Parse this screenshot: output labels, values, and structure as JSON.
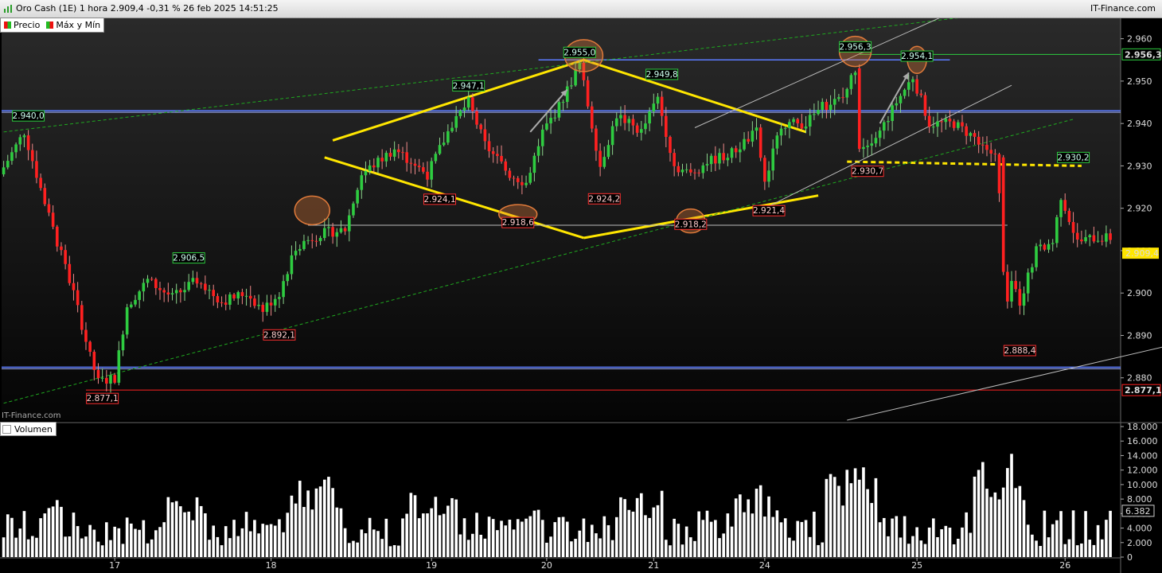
{
  "header": {
    "title": "Oro Cash (1E) 1 hora 2.909,4 -0,31 % 26 feb 2025 14:51:25",
    "brand": "IT-Finance.com"
  },
  "legend": {
    "price": "Precio",
    "maxmin": "Máx y Mín",
    "volume": "Volumen"
  },
  "watermark": "IT-Finance.com",
  "colors": {
    "up": "#2ecc40",
    "down": "#ff2020",
    "background": "#000000",
    "yellow": "#ffe600",
    "blue_line": "#5b7bff",
    "orange_circle": "#e07a3a"
  },
  "chart_data": {
    "type": "candlestick",
    "price_axis": {
      "range": [
        2870,
        2965
      ],
      "ticks": [
        "2.960",
        "2.950",
        "2.940",
        "2.930",
        "2.920",
        "2.910",
        "2.900",
        "2.890",
        "2.880"
      ],
      "tick_values": [
        2960,
        2950,
        2940,
        2930,
        2920,
        2910,
        2900,
        2890,
        2880
      ]
    },
    "volume_axis": {
      "range": [
        0,
        18000
      ],
      "ticks": [
        "18.000",
        "16.000",
        "14.000",
        "12.000",
        "10.000",
        "8.000",
        "6.000",
        "4.000",
        "2.000",
        "0"
      ],
      "tick_values": [
        18000,
        16000,
        14000,
        12000,
        10000,
        8000,
        6000,
        4000,
        2000,
        0
      ]
    },
    "x_labels": [
      "17",
      "18",
      "19",
      "20",
      "21",
      "24",
      "25",
      "26"
    ],
    "x_label_bar_index": [
      27,
      65,
      104,
      132,
      158,
      185,
      222,
      258
    ],
    "last_price": "2.909,4",
    "last_price_value": 2909.4,
    "last_volume": "6.382",
    "last_volume_value": 6382,
    "levels": [
      {
        "label": "2.956,3",
        "value": 2956.3,
        "color": "#2ecc40"
      },
      {
        "label": "2.877,1",
        "value": 2877.1,
        "color": "#ff2020"
      }
    ],
    "blue_levels": [
      2955,
      2943,
      2882.5
    ],
    "annotations": [
      {
        "text": "2.940,0",
        "bar": 6,
        "value": 2940.0,
        "kind": "high"
      },
      {
        "text": "2.906,5",
        "bar": 45,
        "value": 2906.5,
        "kind": "high"
      },
      {
        "text": "2.947,1",
        "bar": 113,
        "value": 2947.1,
        "kind": "high"
      },
      {
        "text": "2.955,0",
        "bar": 140,
        "value": 2955.0,
        "kind": "high"
      },
      {
        "text": "2.949,8",
        "bar": 160,
        "value": 2949.8,
        "kind": "high"
      },
      {
        "text": "2.956,3",
        "bar": 207,
        "value": 2956.3,
        "kind": "high"
      },
      {
        "text": "2.954,1",
        "bar": 222,
        "value": 2954.1,
        "kind": "high"
      },
      {
        "text": "2.930,2",
        "bar": 260,
        "value": 2930.2,
        "kind": "high"
      },
      {
        "text": "2.877,1",
        "bar": 24,
        "value": 2877.1,
        "kind": "low"
      },
      {
        "text": "2.892,1",
        "bar": 67,
        "value": 2892.1,
        "kind": "low"
      },
      {
        "text": "2.924,1",
        "bar": 106,
        "value": 2924.1,
        "kind": "low"
      },
      {
        "text": "2.918,6",
        "bar": 125,
        "value": 2918.6,
        "kind": "low"
      },
      {
        "text": "2.924,2",
        "bar": 146,
        "value": 2924.2,
        "kind": "low"
      },
      {
        "text": "2.918,2",
        "bar": 167,
        "value": 2918.2,
        "kind": "low"
      },
      {
        "text": "2.921,4",
        "bar": 186,
        "value": 2921.4,
        "kind": "low"
      },
      {
        "text": "2.930,7",
        "bar": 210,
        "value": 2930.7,
        "kind": "low"
      },
      {
        "text": "2.888,4",
        "bar": 247,
        "value": 2888.4,
        "kind": "low"
      }
    ],
    "trendlines": [
      {
        "color": "#ffe600",
        "width": 3,
        "dash": "",
        "p1": [
          80,
          2936
        ],
        "p2": [
          141,
          2955
        ]
      },
      {
        "color": "#ffe600",
        "width": 3,
        "dash": "",
        "p1": [
          78,
          2932
        ],
        "p2": [
          141,
          2913
        ]
      },
      {
        "color": "#ffe600",
        "width": 3,
        "dash": "",
        "p1": [
          141,
          2955
        ],
        "p2": [
          195,
          2938
        ]
      },
      {
        "color": "#ffe600",
        "width": 3,
        "dash": "",
        "p1": [
          141,
          2913
        ],
        "p2": [
          198,
          2923
        ]
      },
      {
        "color": "#ffe600",
        "width": 3,
        "dash": "6,4",
        "p1": [
          205,
          2931
        ],
        "p2": [
          262,
          2930
        ]
      },
      {
        "color": "#1fa81f",
        "width": 1,
        "dash": "4,3",
        "p1": [
          0,
          2874
        ],
        "p2": [
          260,
          2941
        ]
      },
      {
        "color": "#1fa81f",
        "width": 1,
        "dash": "4,3",
        "p1": [
          0,
          2938
        ],
        "p2": [
          250,
          2967
        ]
      },
      {
        "color": "#bbbbbb",
        "width": 1,
        "dash": "",
        "p1": [
          74,
          2916
        ],
        "p2": [
          244,
          2916
        ]
      },
      {
        "color": "#bbbbbb",
        "width": 1,
        "dash": "",
        "p1": [
          168,
          2939
        ],
        "p2": [
          230,
          2966
        ]
      },
      {
        "color": "#bbbbbb",
        "width": 1,
        "dash": "",
        "p1": [
          185,
          2920
        ],
        "p2": [
          245,
          2949
        ]
      },
      {
        "color": "#bbbbbb",
        "width": 1,
        "dash": "",
        "p1": [
          205,
          2870
        ],
        "p2": [
          285,
          2888
        ]
      }
    ],
    "circles": [
      {
        "bar": 75,
        "value": 2919.5,
        "rx": 22,
        "ry": 18
      },
      {
        "bar": 125,
        "value": 2918.6,
        "rx": 24,
        "ry": 12
      },
      {
        "bar": 141,
        "value": 2956,
        "rx": 24,
        "ry": 20
      },
      {
        "bar": 167,
        "value": 2917,
        "rx": 18,
        "ry": 15
      },
      {
        "bar": 207,
        "value": 2957,
        "rx": 20,
        "ry": 19
      },
      {
        "bar": 222,
        "value": 2955,
        "rx": 12,
        "ry": 17
      }
    ],
    "arrows": [
      {
        "from": [
          128,
          2938
        ],
        "to": [
          137,
          2948
        ]
      },
      {
        "from": [
          213,
          2940
        ],
        "to": [
          220,
          2952
        ]
      }
    ]
  }
}
